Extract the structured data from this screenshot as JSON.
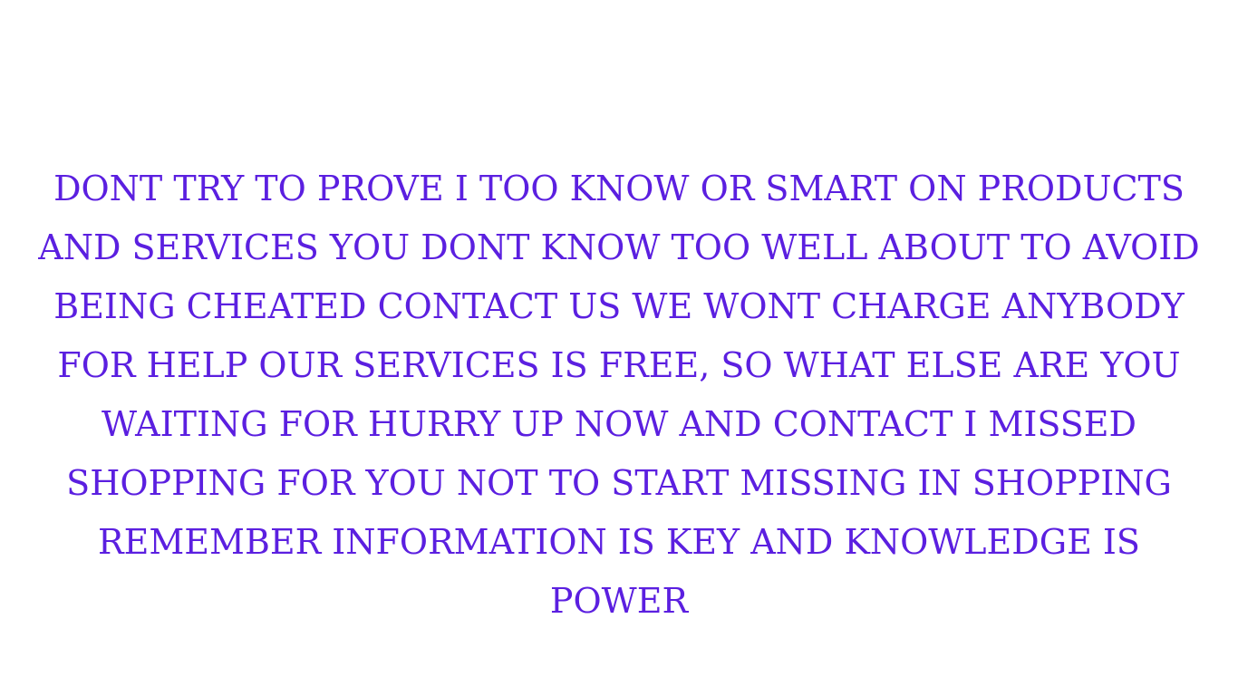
{
  "colors": {
    "background": "#ffffff",
    "text": "#5b1fe0"
  },
  "message": {
    "lines": [
      "DONT TRY TO PROVE I TOO KNOW OR SMART ON PRODUCTS",
      "AND SERVICES YOU DONT KNOW TOO WELL ABOUT TO AVOID",
      "BEING CHEATED CONTACT US WE WONT CHARGE ANYBODY",
      "FOR HELP OUR SERVICES IS FREE, SO WHAT ELSE ARE YOU",
      "WAITING FOR HURRY UP NOW AND CONTACT I MISSED",
      "SHOPPING FOR YOU NOT TO START MISSING IN SHOPPING",
      "REMEMBER INFORMATION IS KEY AND KNOWLEDGE IS",
      "POWER"
    ]
  }
}
